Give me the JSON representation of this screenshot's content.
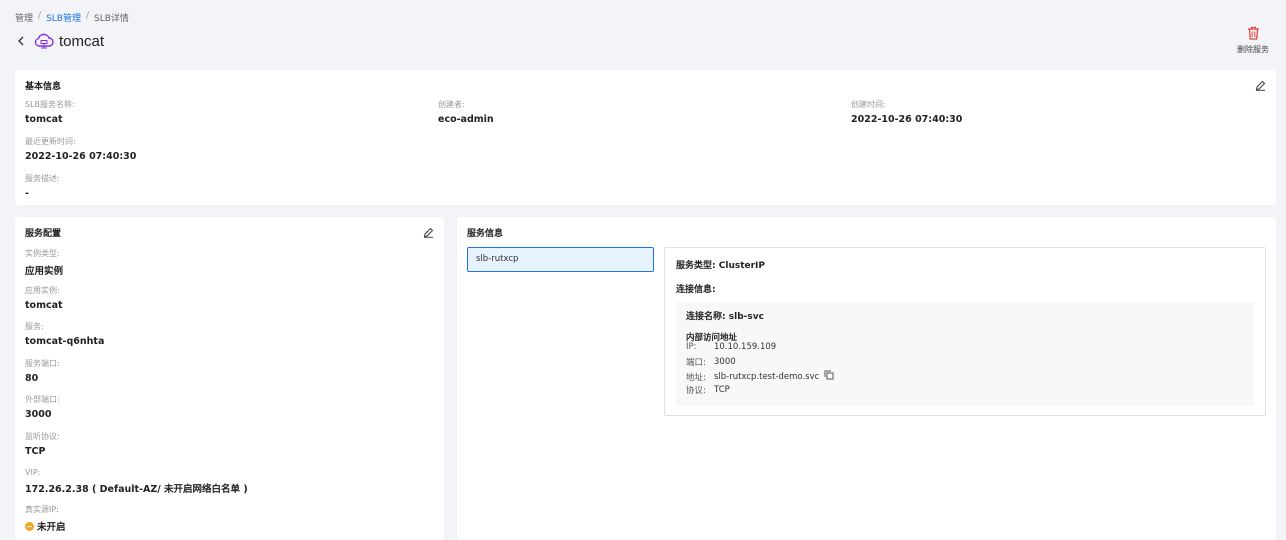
{
  "breadcrumb": [
    "管理",
    "SLB管理",
    "SLB详情"
  ],
  "header": {
    "title": "tomcat"
  },
  "actions": {
    "delete_label": "删除服务"
  },
  "basic_info": {
    "title": "基本信息",
    "fields": [
      {
        "label": "SLB服务名称:",
        "value": "tomcat"
      },
      {
        "label": "创建者:",
        "value": "eco-admin"
      },
      {
        "label": "创建时间:",
        "value": "2022-10-26 07:40:30"
      },
      {
        "label": "最近更新时间:",
        "value": "2022-10-26 07:40:30"
      },
      {
        "label": "服务描述:",
        "value": "-"
      }
    ]
  },
  "service_config": {
    "title": "服务配置",
    "fields": [
      {
        "label": "实例类型:",
        "value": "应用实例"
      },
      {
        "label": "应用实例:",
        "value": "tomcat"
      },
      {
        "label": "服务:",
        "value": "tomcat-q6nhta"
      },
      {
        "label": "服务端口:",
        "value": "80"
      },
      {
        "label": "外部端口:",
        "value": "3000"
      },
      {
        "label": "监听协议:",
        "value": "TCP"
      },
      {
        "label": "VIP:",
        "value": "172.26.2.38 ( Default-AZ/ 未开启网络白名单 )"
      },
      {
        "label": "真实源IP:",
        "value": "未开启"
      }
    ]
  },
  "service_info": {
    "title": "服务信息",
    "selected_item": "slb-rutxcp",
    "type_label": "服务类型:",
    "type_value": "ClusterIP",
    "conn_title": "连接信息:",
    "conn_name_label": "连接名称:",
    "conn_name_value": "slb-svc",
    "internal_title": "内部访问地址",
    "ip_label": "IP:",
    "ip_value": "10.10.159.109",
    "port_label": "端口:",
    "port_value": "3000",
    "addr_label": "地址:",
    "addr_value": "slb-rutxcp.test-demo.svc",
    "proto_label": "协议:",
    "proto_value": "TCP"
  },
  "colors": {
    "accent": "#1a73e8",
    "danger": "#e0463c",
    "brand_icon": "#8a2be2",
    "warning": "#f5a623"
  },
  "icons": [
    "back-icon",
    "cloud-service-icon",
    "trash-icon",
    "edit-icon",
    "copy-icon",
    "status-off-icon"
  ]
}
